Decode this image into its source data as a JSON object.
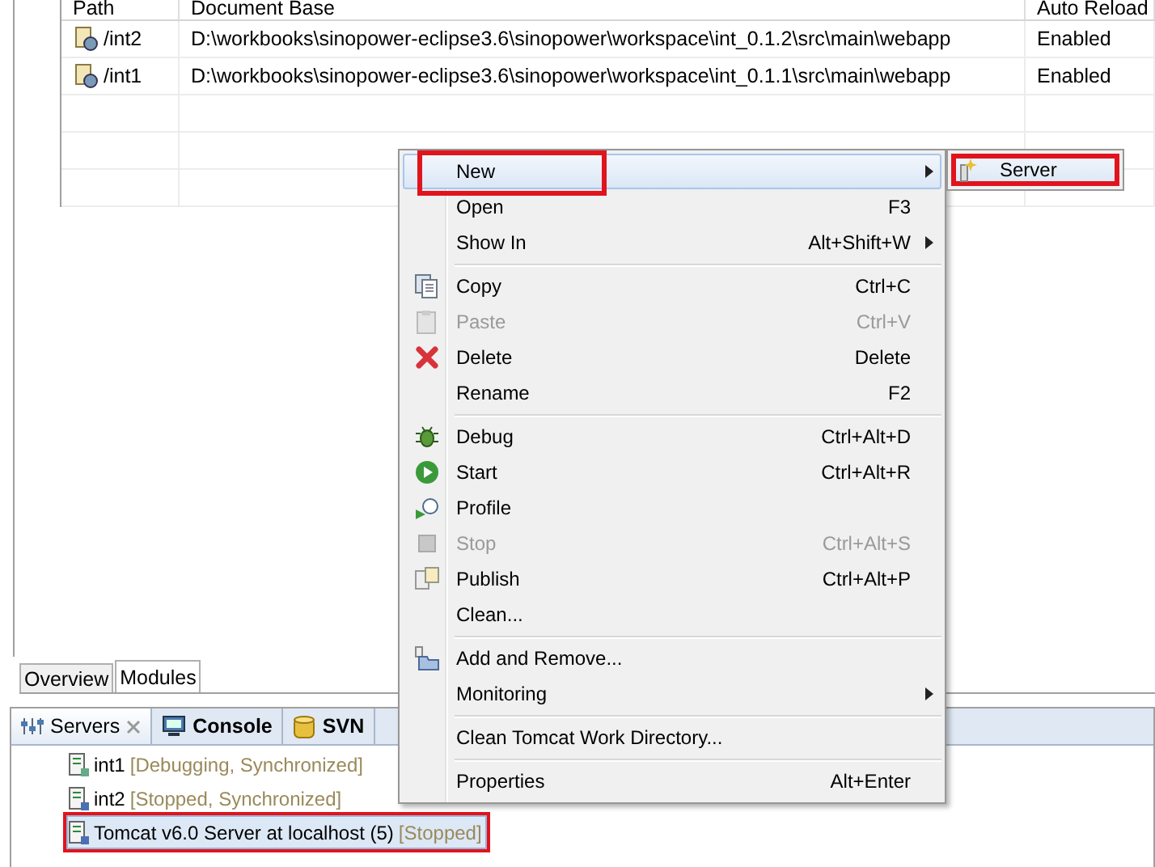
{
  "modules_table": {
    "columns": [
      "Path",
      "Document Base",
      "Auto Reload"
    ],
    "rows": [
      {
        "path": "/int2",
        "document_base": "D:\\workbooks\\sinopower-eclipse3.6\\sinopower\\workspace\\int_0.1.2\\src\\main\\webapp",
        "auto_reload": "Enabled"
      },
      {
        "path": "/int1",
        "document_base": "D:\\workbooks\\sinopower-eclipse3.6\\sinopower\\workspace\\int_0.1.1\\src\\main\\webapp",
        "auto_reload": "Enabled"
      }
    ]
  },
  "editor_tabs": [
    {
      "label": "Overview",
      "selected": false
    },
    {
      "label": "Modules",
      "selected": true
    }
  ],
  "view_tabs": [
    {
      "label": "Servers",
      "selected": true,
      "closable": true
    },
    {
      "label": "Console",
      "selected": false,
      "closable": false
    },
    {
      "label": "SVN",
      "selected": false,
      "closable": false
    }
  ],
  "servers": [
    {
      "name": "int1",
      "status": "[Debugging, Synchronized]",
      "selected": false,
      "annotated": false
    },
    {
      "name": "int2",
      "status": "[Stopped, Synchronized]",
      "selected": false,
      "annotated": false
    },
    {
      "name": "Tomcat v6.0 Server at localhost (5)",
      "status": "[Stopped]",
      "selected": true,
      "annotated": true
    }
  ],
  "context_menu": {
    "items": [
      {
        "kind": "plain",
        "label": "New",
        "submenu": true,
        "disabled": false,
        "selected": true,
        "annotated": true
      },
      {
        "kind": "plain",
        "label": "Open",
        "shortcut": "F3",
        "submenu": false,
        "disabled": false,
        "selected": false,
        "annotated": false
      },
      {
        "kind": "plain",
        "label": "Show In",
        "shortcut": "Alt+Shift+W",
        "submenu": true,
        "disabled": false,
        "selected": false,
        "annotated": false
      },
      {
        "kind": "separator"
      },
      {
        "kind": "copy",
        "label": "Copy",
        "shortcut": "Ctrl+C",
        "submenu": false,
        "disabled": false,
        "selected": false,
        "annotated": false
      },
      {
        "kind": "paste",
        "label": "Paste",
        "shortcut": "Ctrl+V",
        "submenu": false,
        "disabled": true,
        "selected": false,
        "annotated": false
      },
      {
        "kind": "delete",
        "label": "Delete",
        "shortcut": "Delete",
        "submenu": false,
        "disabled": false,
        "selected": false,
        "annotated": false
      },
      {
        "kind": "plain",
        "label": "Rename",
        "shortcut": "F2",
        "submenu": false,
        "disabled": false,
        "selected": false,
        "annotated": false
      },
      {
        "kind": "separator"
      },
      {
        "kind": "debug",
        "label": "Debug",
        "shortcut": "Ctrl+Alt+D",
        "submenu": false,
        "disabled": false,
        "selected": false,
        "annotated": false
      },
      {
        "kind": "start",
        "label": "Start",
        "shortcut": "Ctrl+Alt+R",
        "submenu": false,
        "disabled": false,
        "selected": false,
        "annotated": false
      },
      {
        "kind": "profile",
        "label": "Profile",
        "submenu": false,
        "disabled": false,
        "selected": false,
        "annotated": false
      },
      {
        "kind": "stop",
        "label": "Stop",
        "shortcut": "Ctrl+Alt+S",
        "submenu": false,
        "disabled": true,
        "selected": false,
        "annotated": false
      },
      {
        "kind": "publish",
        "label": "Publish",
        "shortcut": "Ctrl+Alt+P",
        "submenu": false,
        "disabled": false,
        "selected": false,
        "annotated": false
      },
      {
        "kind": "plain",
        "label": "Clean...",
        "submenu": false,
        "disabled": false,
        "selected": false,
        "annotated": false
      },
      {
        "kind": "separator"
      },
      {
        "kind": "add-remove",
        "label": "Add and Remove...",
        "submenu": false,
        "disabled": false,
        "selected": false,
        "annotated": false
      },
      {
        "kind": "plain",
        "label": "Monitoring",
        "submenu": true,
        "disabled": false,
        "selected": false,
        "annotated": false
      },
      {
        "kind": "separator"
      },
      {
        "kind": "plain",
        "label": "Clean Tomcat Work Directory...",
        "submenu": false,
        "disabled": false,
        "selected": false,
        "annotated": false
      },
      {
        "kind": "separator"
      },
      {
        "kind": "plain",
        "label": "Properties",
        "shortcut": "Alt+Enter",
        "submenu": false,
        "disabled": false,
        "selected": false,
        "annotated": false
      }
    ]
  },
  "submenu": {
    "items": [
      {
        "label": "Server",
        "selected": true,
        "annotated": true
      }
    ]
  }
}
